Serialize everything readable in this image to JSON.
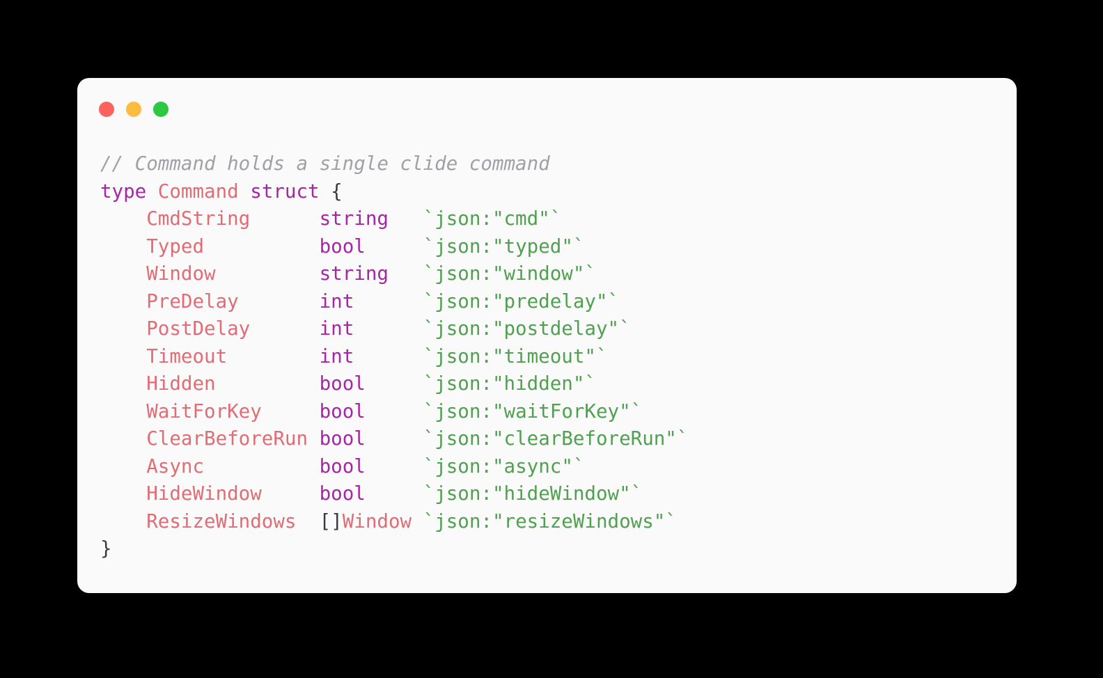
{
  "window": {
    "controls": [
      {
        "name": "close",
        "color": "#FC625D"
      },
      {
        "name": "minimize",
        "color": "#FDBC40"
      },
      {
        "name": "zoom",
        "color": "#2BC840"
      }
    ]
  },
  "theme": {
    "background": "#000000",
    "card_background": "#FAFAFA",
    "comment": "#A0A1A7",
    "keyword": "#A626A4",
    "type_name": "#E06C75",
    "field_name": "#E06C75",
    "builtin_type": "#A626A4",
    "struct_tag": "#50A14F",
    "punctuation": "#383A42"
  },
  "code": {
    "language": "go",
    "comment": "// Command holds a single clide command",
    "declaration": {
      "keyword_type": "type",
      "name": "Command",
      "keyword_struct": "struct",
      "open_brace": "{",
      "close_brace": "}"
    },
    "fields": [
      {
        "name": "CmdString",
        "type": "string",
        "type_prefix": "",
        "tag": "`json:\"cmd\"`"
      },
      {
        "name": "Typed",
        "type": "bool",
        "type_prefix": "",
        "tag": "`json:\"typed\"`"
      },
      {
        "name": "Window",
        "type": "string",
        "type_prefix": "",
        "tag": "`json:\"window\"`"
      },
      {
        "name": "PreDelay",
        "type": "int",
        "type_prefix": "",
        "tag": "`json:\"predelay\"`"
      },
      {
        "name": "PostDelay",
        "type": "int",
        "type_prefix": "",
        "tag": "`json:\"postdelay\"`"
      },
      {
        "name": "Timeout",
        "type": "int",
        "type_prefix": "",
        "tag": "`json:\"timeout\"`"
      },
      {
        "name": "Hidden",
        "type": "bool",
        "type_prefix": "",
        "tag": "`json:\"hidden\"`"
      },
      {
        "name": "WaitForKey",
        "type": "bool",
        "type_prefix": "",
        "tag": "`json:\"waitForKey\"`"
      },
      {
        "name": "ClearBeforeRun",
        "type": "bool",
        "type_prefix": "",
        "tag": "`json:\"clearBeforeRun\"`"
      },
      {
        "name": "Async",
        "type": "bool",
        "type_prefix": "",
        "tag": "`json:\"async\"`"
      },
      {
        "name": "HideWindow",
        "type": "bool",
        "type_prefix": "",
        "tag": "`json:\"hideWindow\"`"
      },
      {
        "name": "ResizeWindows",
        "type": "Window",
        "type_prefix": "[]",
        "tag": "`json:\"resizeWindows\"`"
      }
    ],
    "layout": {
      "indent": "    ",
      "name_column_width": 15,
      "type_column_width": 9
    }
  }
}
